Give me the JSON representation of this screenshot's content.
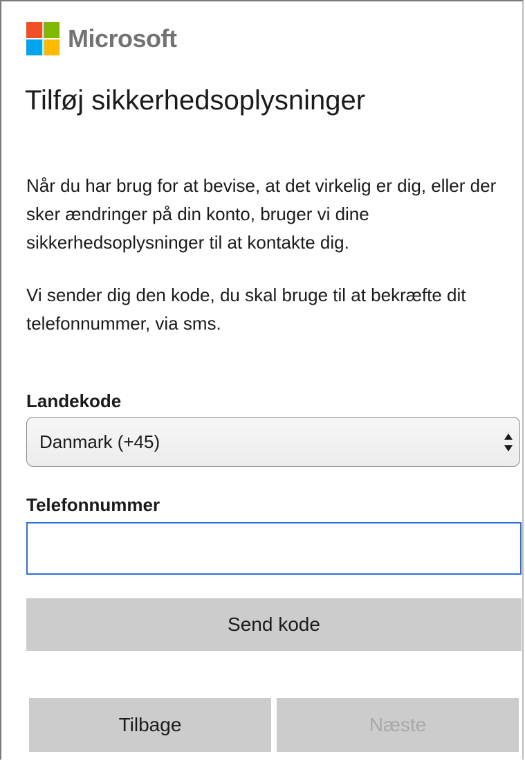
{
  "brand": {
    "name": "Microsoft",
    "colors": [
      "#f25022",
      "#7fba00",
      "#00a4ef",
      "#ffb900"
    ]
  },
  "page": {
    "title": "Tilføj sikkerhedsoplysninger",
    "paragraph1": "Når du har brug for at bevise, at det virkelig er dig, eller der sker ændringer på din konto, bruger vi dine sikkerhedsoplysninger til at kontakte dig.",
    "paragraph2": "Vi sender dig den kode, du skal bruge til at bekræfte dit telefonnummer, via sms."
  },
  "form": {
    "country_label": "Landekode",
    "country_value": "Danmark (+45)",
    "phone_label": "Telefonnummer",
    "phone_value": "",
    "phone_focus_color": "#2f6fd8"
  },
  "buttons": {
    "send": "Send kode",
    "back": "Tilbage",
    "next": "Næste"
  },
  "icons": {
    "select_arrows": "up-down-chevron-icon"
  }
}
